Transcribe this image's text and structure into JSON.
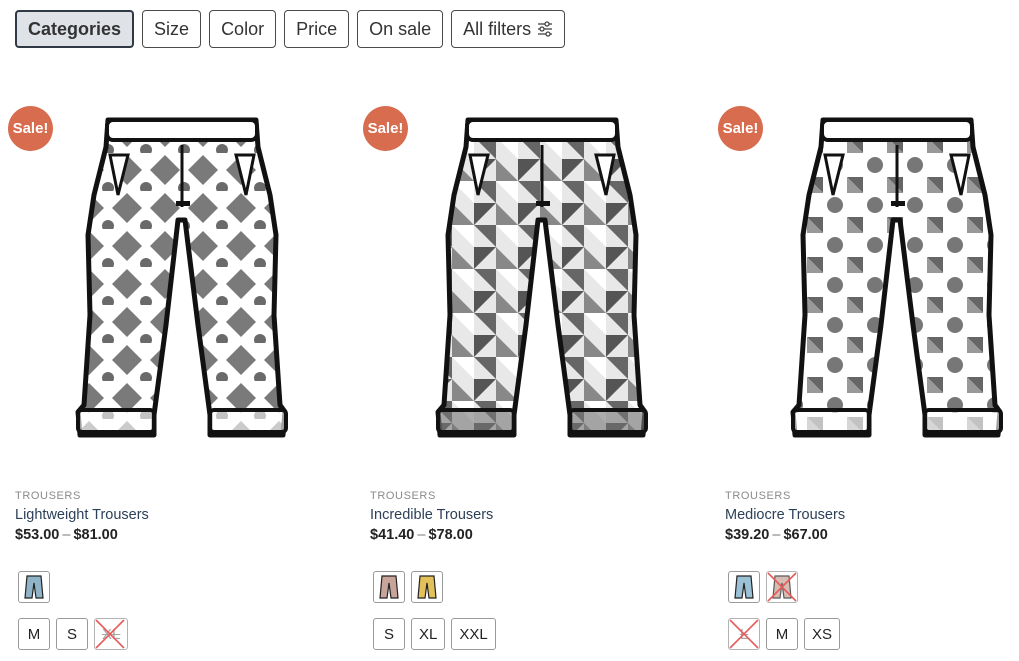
{
  "filters": {
    "categories": "Categories",
    "size": "Size",
    "color": "Color",
    "price": "Price",
    "on_sale": "On sale",
    "all_filters": "All filters"
  },
  "products": [
    {
      "badge": "Sale!",
      "category": "TROUSERS",
      "name": "Lightweight Trousers",
      "price_min": "$53.00",
      "price_sep": "–",
      "price_max": "$81.00",
      "color_swatches": [
        {
          "color": "#8fb4c7",
          "available": true
        }
      ],
      "sizes": [
        {
          "label": "M",
          "available": true
        },
        {
          "label": "S",
          "available": true
        },
        {
          "label": "XL",
          "available": false
        }
      ]
    },
    {
      "badge": "Sale!",
      "category": "TROUSERS",
      "name": "Incredible Trousers",
      "price_min": "$41.40",
      "price_sep": "–",
      "price_max": "$78.00",
      "color_swatches": [
        {
          "color": "#c9a49a",
          "available": true
        },
        {
          "color": "#e2c15a",
          "available": true
        }
      ],
      "sizes": [
        {
          "label": "S",
          "available": true
        },
        {
          "label": "XL",
          "available": true
        },
        {
          "label": "XXL",
          "available": true
        }
      ]
    },
    {
      "badge": "Sale!",
      "category": "TROUSERS",
      "name": "Mediocre Trousers",
      "price_min": "$39.20",
      "price_sep": "–",
      "price_max": "$67.00",
      "color_swatches": [
        {
          "color": "#9cc0d6",
          "available": true
        },
        {
          "color": "#c9a89a",
          "available": false
        }
      ],
      "sizes": [
        {
          "label": "L",
          "available": false
        },
        {
          "label": "M",
          "available": true
        },
        {
          "label": "XS",
          "available": true
        }
      ]
    }
  ],
  "colors": {
    "sale_badge": "#d86c4e",
    "active_chip_bg": "#dfe3e8",
    "product_name": "#2c4058",
    "unavailable_cross": "#e02424"
  }
}
